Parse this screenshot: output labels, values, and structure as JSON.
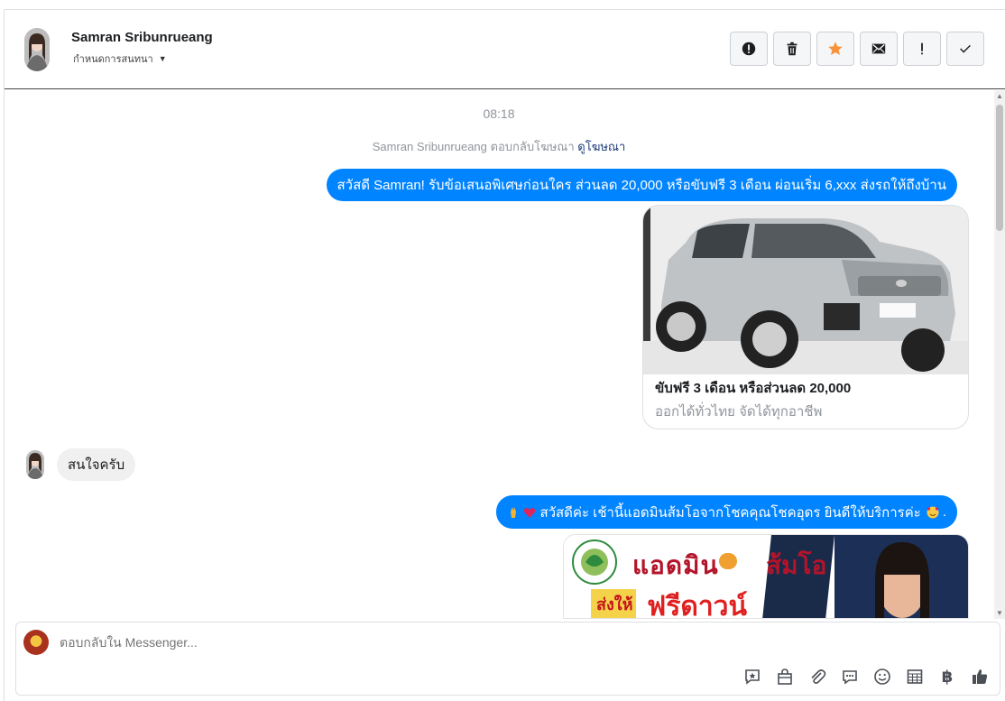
{
  "header": {
    "contact_name": "Samran Sribunrueang",
    "topic_label": "กำหนดการสนทนา",
    "actions": [
      {
        "name": "spam-button",
        "icon": "exclamation-circle-icon"
      },
      {
        "name": "delete-button",
        "icon": "trash-icon"
      },
      {
        "name": "star-button",
        "icon": "star-icon",
        "color": "#f7923a"
      },
      {
        "name": "mark-unread-button",
        "icon": "envelope-icon"
      },
      {
        "name": "important-button",
        "icon": "exclamation-icon"
      },
      {
        "name": "done-button",
        "icon": "checkmark-icon"
      }
    ]
  },
  "conversation": {
    "timestamp": "08:18",
    "ad_reply_prefix": "Samran Sribunrueang ตอบกลับโฆษณา",
    "ad_link": "ดูโฆษณา",
    "outgoing_1": "สวัสดี Samran! รับข้อเสนอพิเศษก่อนใคร ส่วนลด 20,000 หรือขับฟรี 3 เดือน ผ่อนเริ่ม 6,xxx ส่งรถให้ถึงบ้าน",
    "card": {
      "title": "ขับฟรี 3 เดือน หรือส่วนลด 20,000",
      "subtitle": "ออกได้ทั่วไทย จัดได้ทุกอาชีพ"
    },
    "incoming_1": "สนใจครับ",
    "outgoing_2": "สวัสดีค่ะ เช้านี้แอดมินส้มโอจากโชคคุณโชคอุดร ยินดีให้บริการค่ะ",
    "outgoing_2_end": ".",
    "banner": {
      "line1_left": "แอดมิน",
      "line1_right": "ส้มโอ",
      "line2": "ฟรีดาวน์",
      "badge": "ส่งให้"
    }
  },
  "composer": {
    "placeholder": "ตอบกลับใน Messenger...",
    "tools": [
      "saved-reply-icon",
      "shop-bag-icon",
      "attachment-icon",
      "chat-bubble-icon",
      "emoji-icon",
      "table-icon",
      "baht-icon",
      "thumbs-up-icon"
    ],
    "baht_symbol": "฿"
  },
  "colors": {
    "accent": "#0084ff",
    "star": "#f7923a",
    "incoming_bubble": "#f1f0f0"
  }
}
